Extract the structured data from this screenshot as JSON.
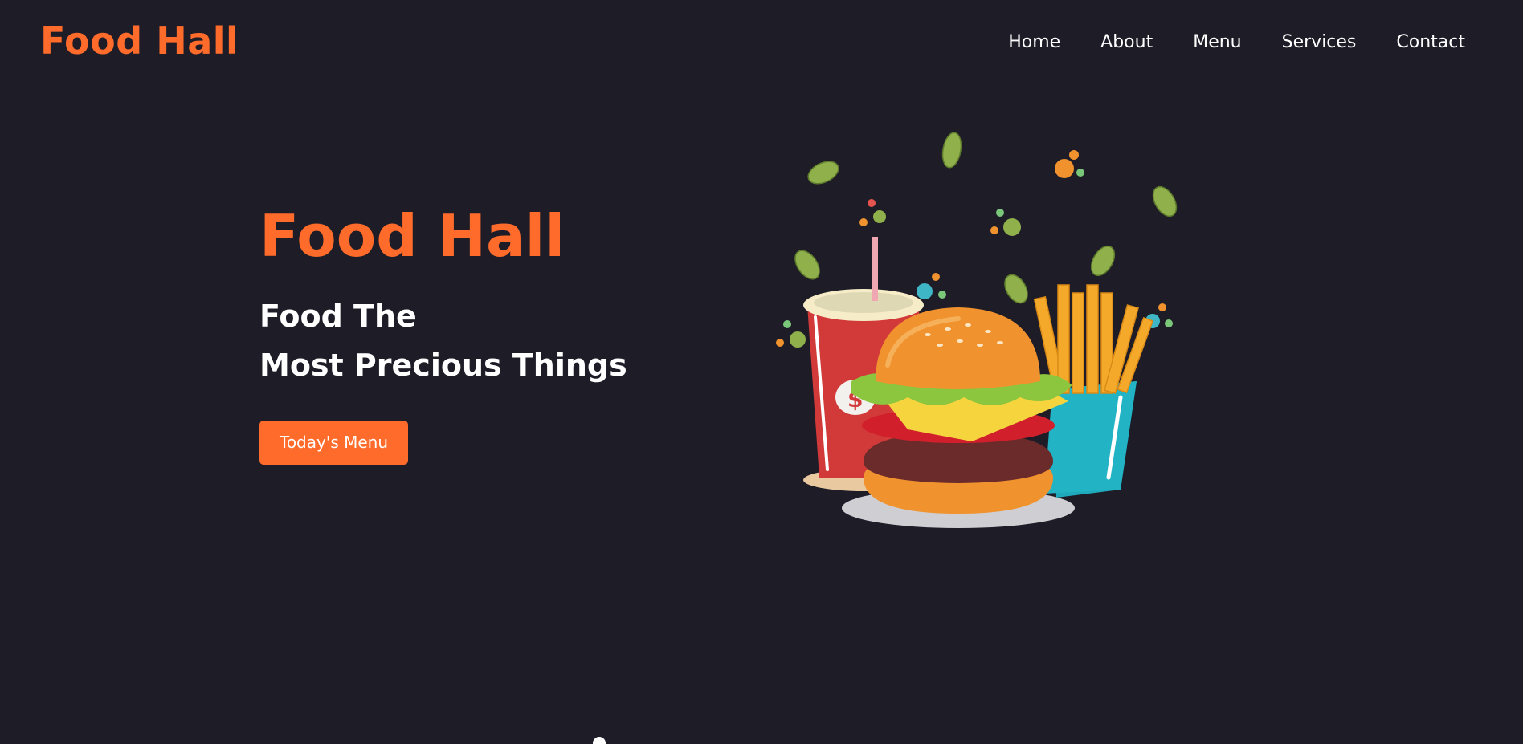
{
  "header": {
    "brand": "Food Hall",
    "nav": [
      {
        "label": "Home"
      },
      {
        "label": "About"
      },
      {
        "label": "Menu"
      },
      {
        "label": "Services"
      },
      {
        "label": "Contact"
      }
    ]
  },
  "hero": {
    "title": "Food Hall",
    "subtitle_line1": "Food The",
    "subtitle_line2": "Most Precious Things",
    "button_label": "Today's Menu",
    "illustration": "burger-fries-drink-illustration"
  },
  "colors": {
    "background": "#1e1c27",
    "accent": "#ff6b2b",
    "text": "#ffffff"
  }
}
